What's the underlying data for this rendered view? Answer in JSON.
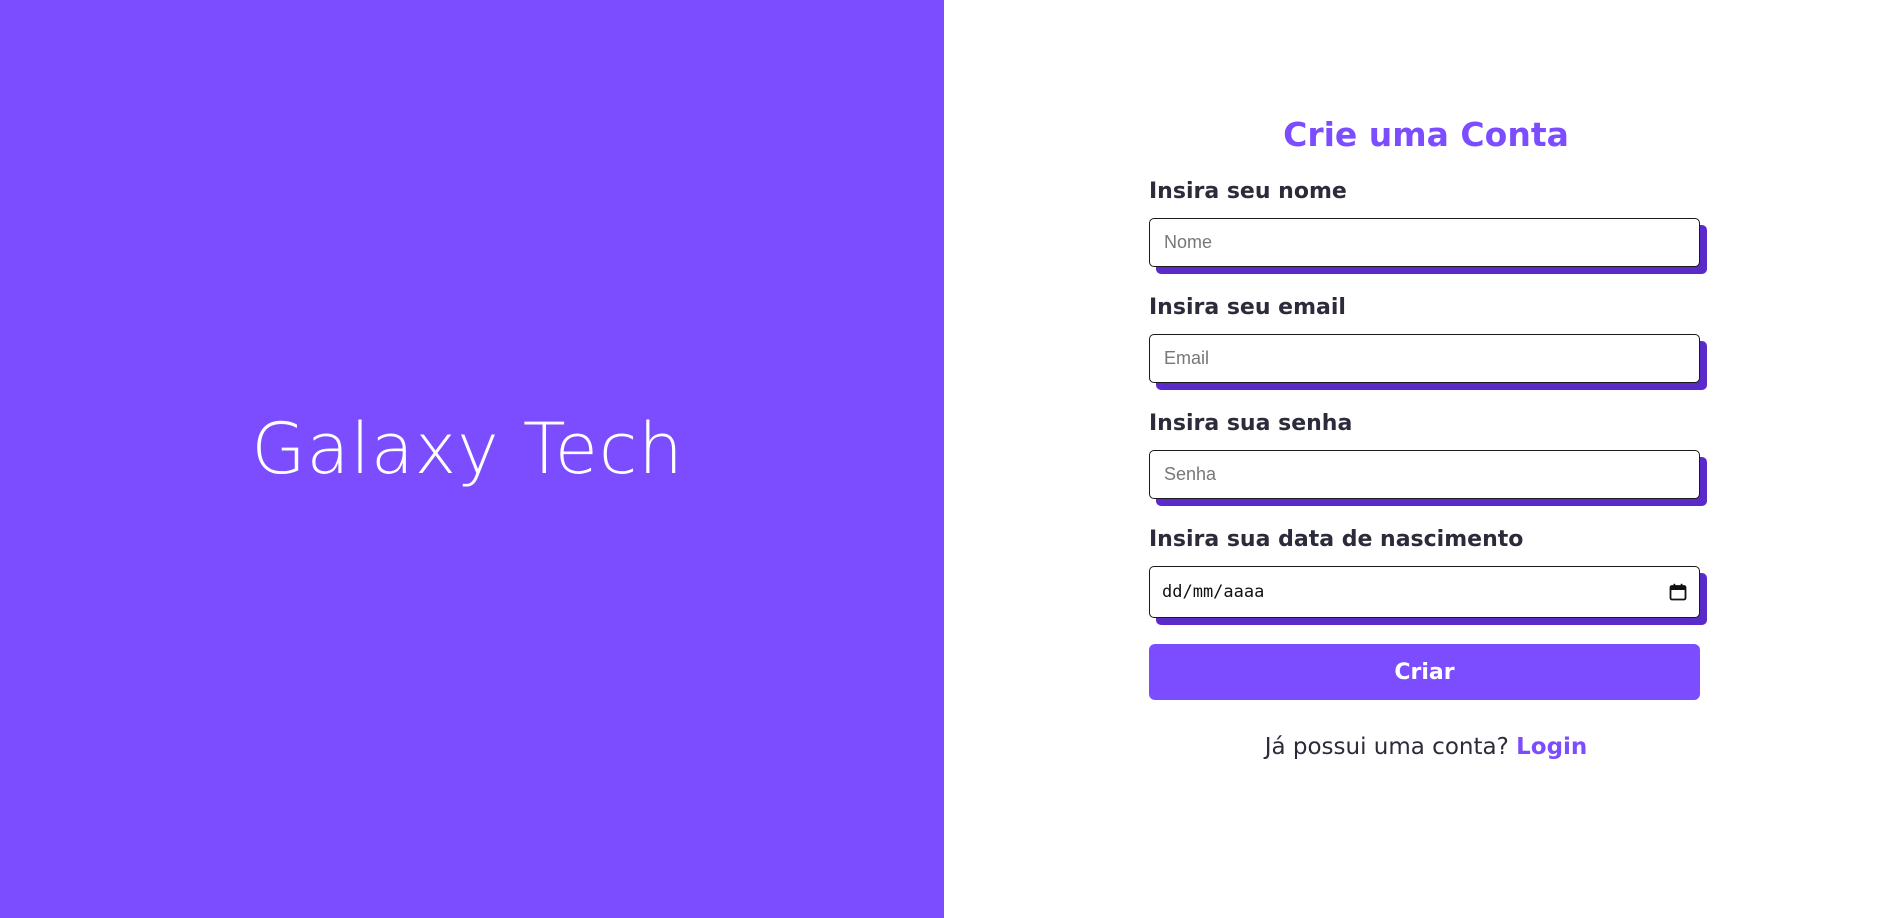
{
  "brand": {
    "title": "Galaxy Tech",
    "color": "#7c4dff"
  },
  "form": {
    "title": "Crie uma Conta",
    "fields": [
      {
        "label": "Insira seu nome",
        "placeholder": "Nome",
        "value": ""
      },
      {
        "label": "Insira seu email",
        "placeholder": "Email",
        "value": ""
      },
      {
        "label": "Insira sua senha",
        "placeholder": "Senha",
        "value": ""
      },
      {
        "label": "Insira sua data de nascimento",
        "placeholder": "dd/mm/aaaa",
        "value": "",
        "icon": "calendar-icon"
      }
    ],
    "submit_label": "Criar",
    "login_prompt": "Já possui uma conta?",
    "login_link": "Login"
  },
  "colors": {
    "accent": "#7c4dff",
    "input_shadow": "#5a2bc9",
    "text": "#2b2b3a"
  }
}
